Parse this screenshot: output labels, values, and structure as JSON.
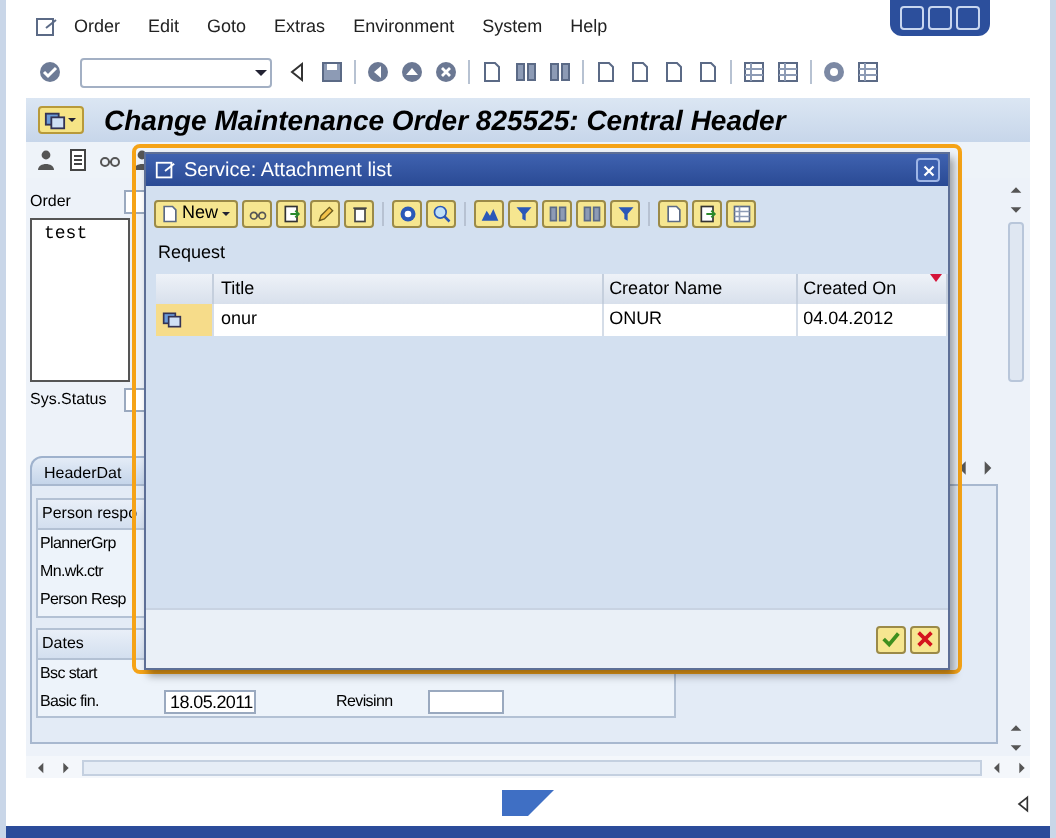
{
  "menu": [
    "Order",
    "Edit",
    "Goto",
    "Extras",
    "Environment",
    "System",
    "Help"
  ],
  "title": "Change Maintenance Order 825525: Central Header",
  "header": {
    "order_label": "Order",
    "notes": "test",
    "status_label": "Sys.Status"
  },
  "tabs": [
    {
      "label": "HeaderDat",
      "selected": true
    }
  ],
  "responsible": {
    "title": "Person respo",
    "fields": [
      "PlannerGrp",
      "Mn.wk.ctr",
      "Person Resp"
    ]
  },
  "dates": {
    "title": "Dates",
    "rows": [
      {
        "label": "Bsc start"
      },
      {
        "label": "Basic fin.",
        "value": "18.05.2011",
        "label_2": "Revisinn"
      }
    ]
  },
  "dialog": {
    "title": "Service: Attachment list",
    "new_button": "New",
    "section": "Request",
    "columns": [
      {
        "label": "Title",
        "sorted": false
      },
      {
        "label": "Creator Name",
        "sorted": false
      },
      {
        "label": "Created On",
        "sorted": true
      }
    ],
    "rows": [
      {
        "title": "onur",
        "creator": "ONUR",
        "created_on": "04.04.2012",
        "selected": false
      }
    ]
  }
}
